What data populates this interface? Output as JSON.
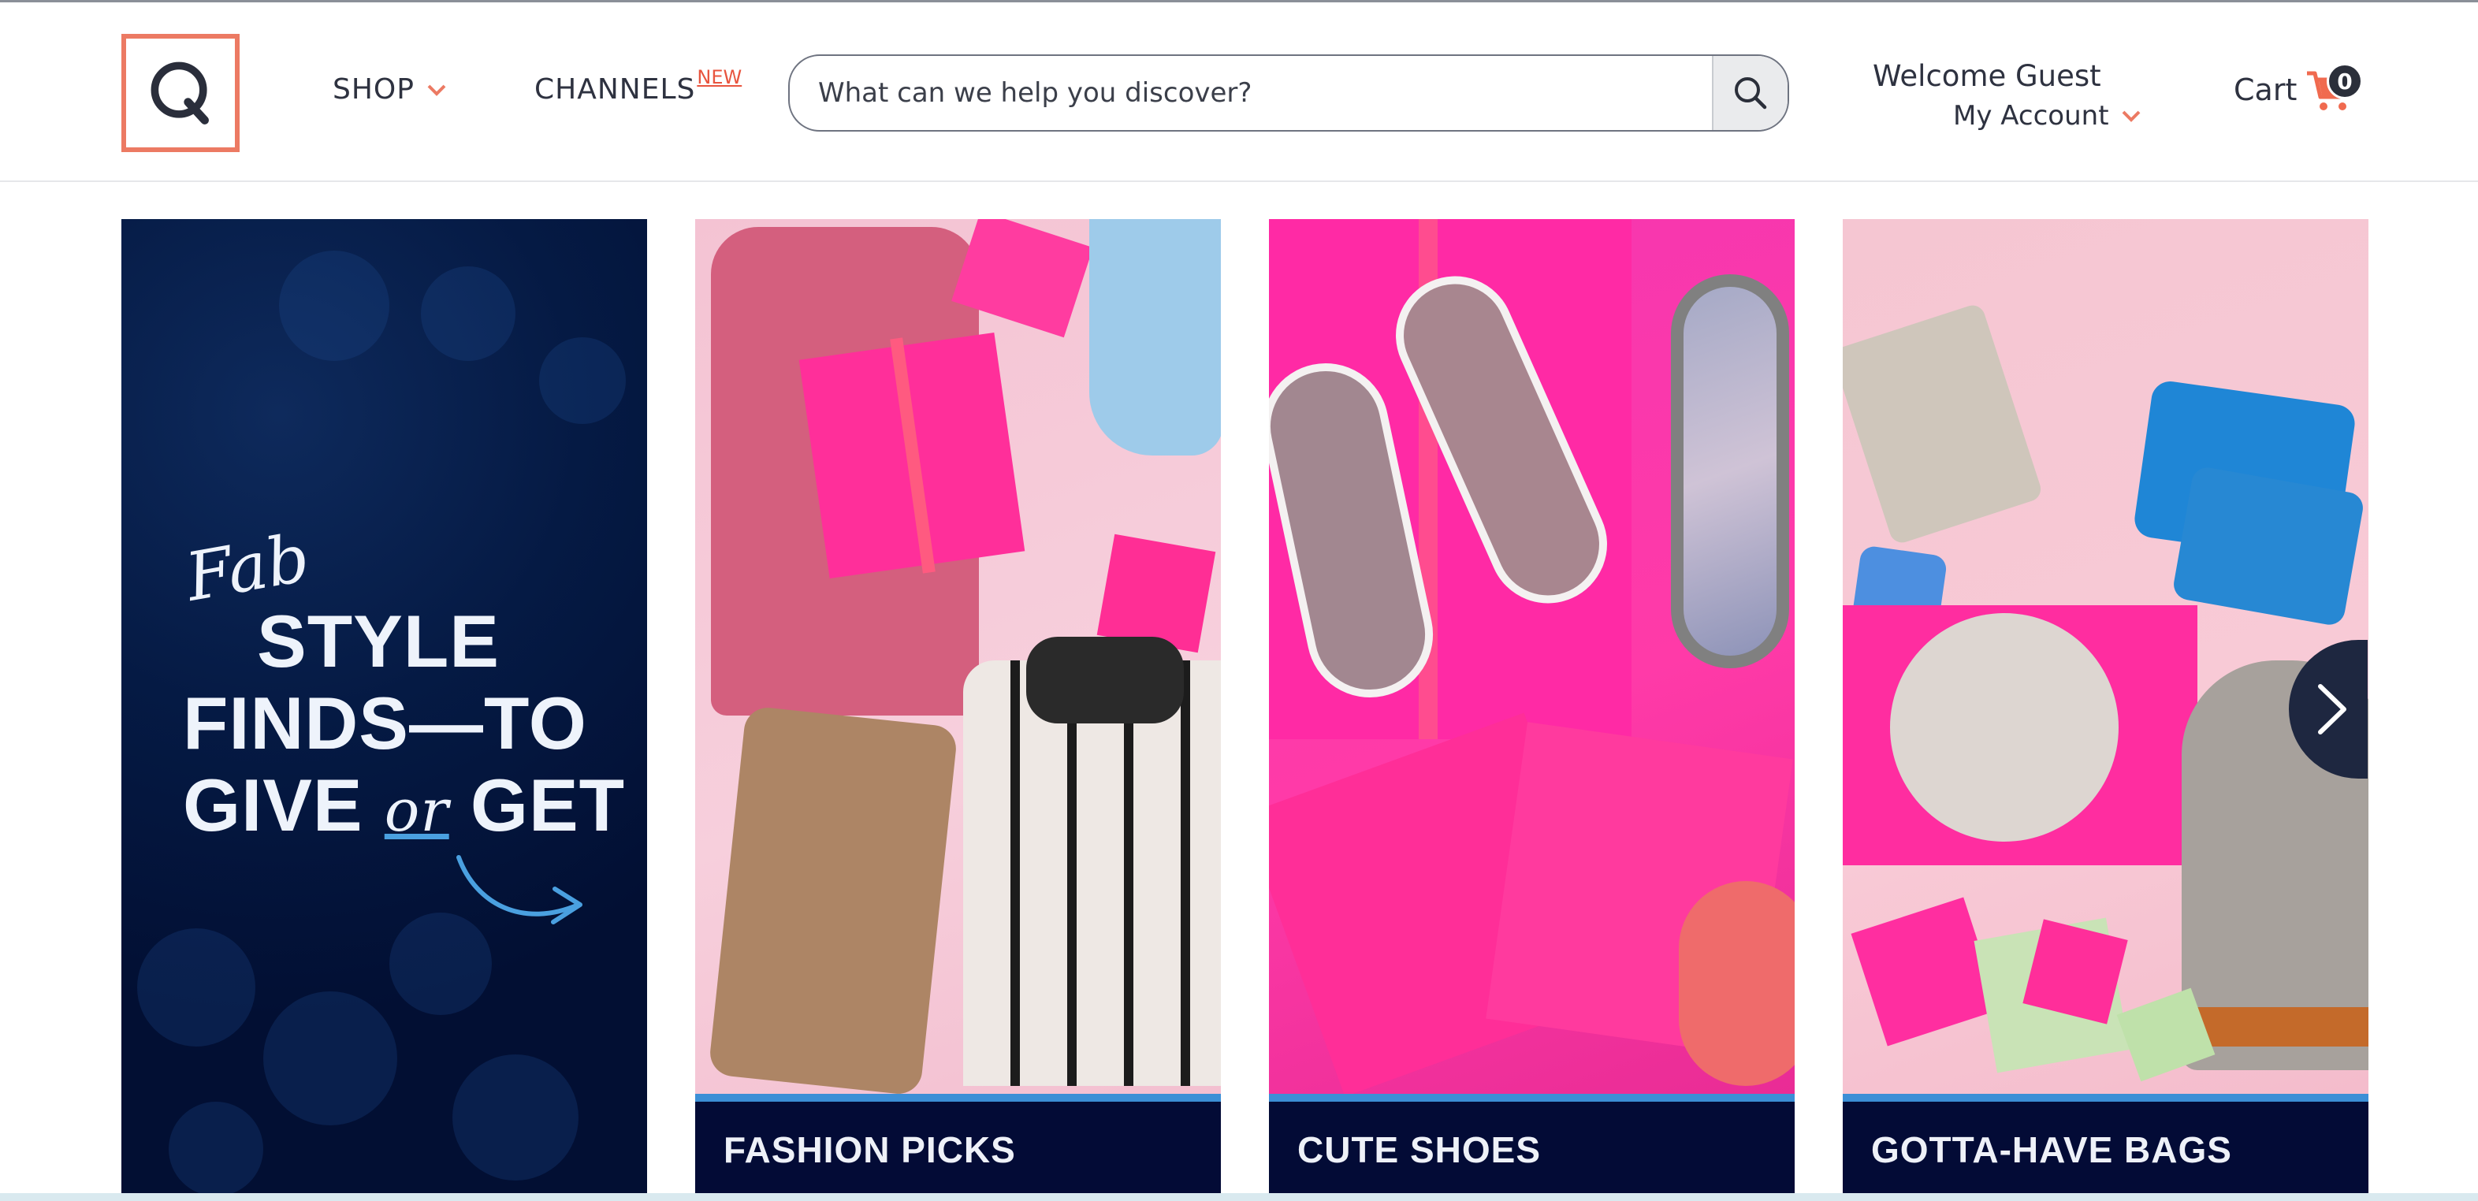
{
  "header": {
    "logo_letter": "Q",
    "nav": {
      "shop_label": "SHOP",
      "channels_label": "CHANNELS",
      "channels_badge": "NEW"
    },
    "search": {
      "placeholder": "What can we help you discover?",
      "value": ""
    },
    "account": {
      "welcome": "Welcome Guest",
      "my_account": "My Account"
    },
    "cart": {
      "label": "Cart",
      "count": "0"
    }
  },
  "carousel": {
    "promo": {
      "script": "Fab",
      "line1": "STYLE",
      "line2": "FINDS—TO",
      "line3_a": "GIVE",
      "line3_or": "or",
      "line3_b": "GET"
    },
    "tiles": [
      {
        "caption": "FASHION PICKS"
      },
      {
        "caption": "CUTE SHOES"
      },
      {
        "caption": "GOTTA-HAVE BAGS"
      }
    ],
    "next_icon": "chevron-right-icon"
  },
  "colors": {
    "accent": "#ec7a63",
    "cart_orange": "#f06a4f",
    "promo_navy": "#020f33",
    "caption_navy": "#030b36",
    "caption_stripe": "#3c8fd6"
  }
}
